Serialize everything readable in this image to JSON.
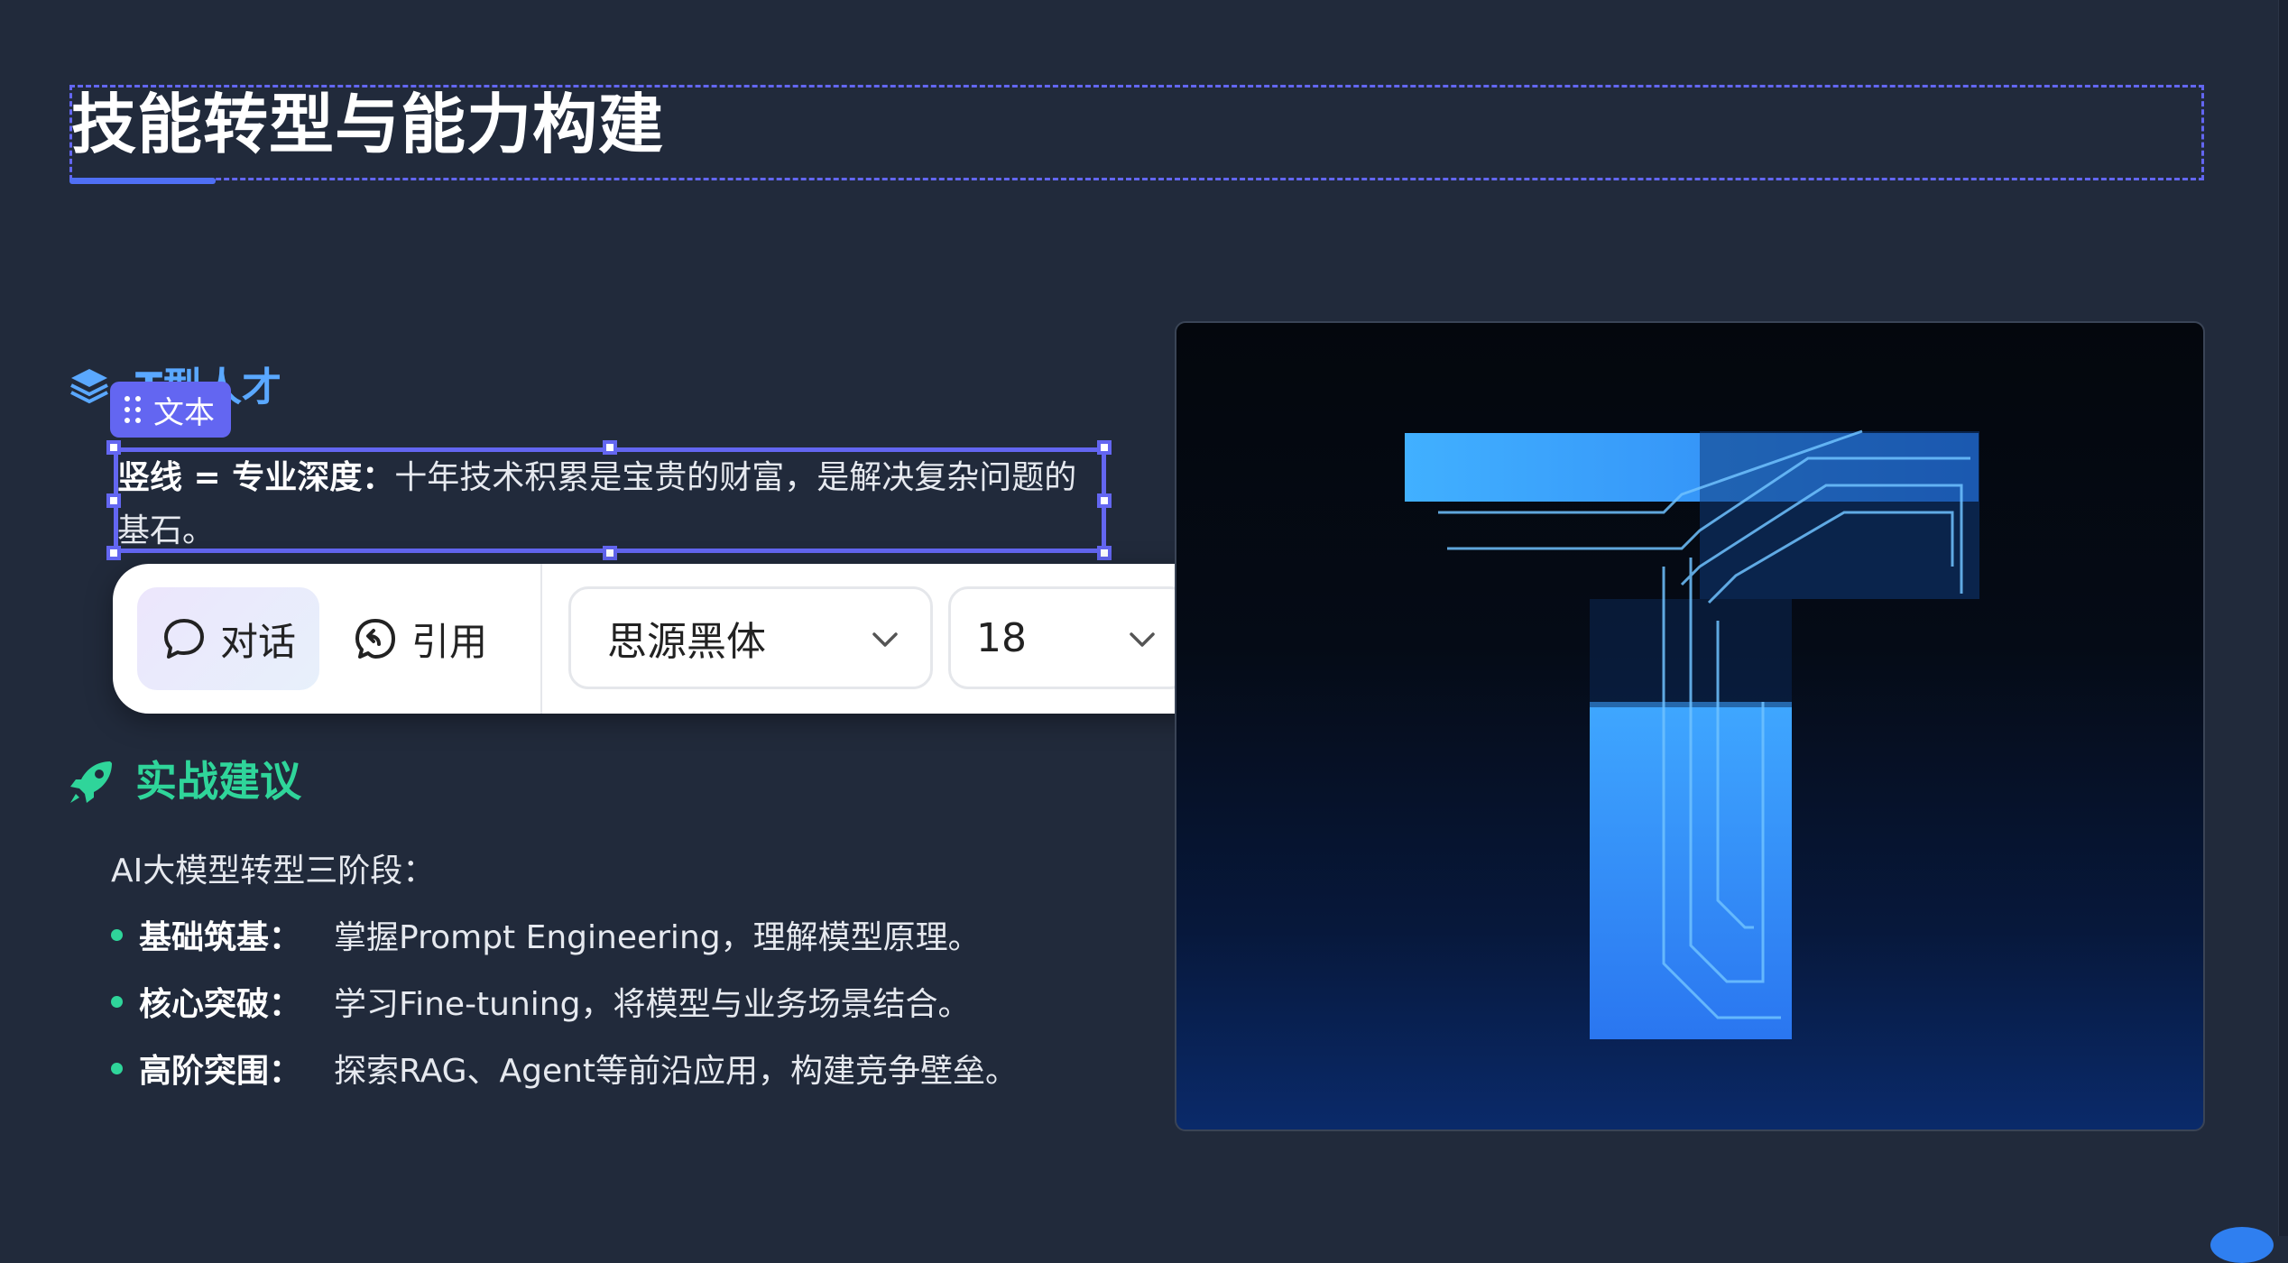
{
  "title": "技能转型与能力构建",
  "section1": {
    "heading": "T型人才",
    "tag_label": "文本",
    "selected_text": {
      "bold": "竖线 = 专业深度：",
      "rest": "十年技术积累是宝贵的财富，是解决复杂问题的基石。"
    }
  },
  "toolbar": {
    "chat_label": "对话",
    "quote_label": "引用",
    "font_family": "思源黑体",
    "font_size": "18",
    "icons": [
      "chat-icon",
      "quote-icon",
      "chevron-down-icon",
      "text-style-icon",
      "bold-icon",
      "italic-icon",
      "underline-icon",
      "trash-icon"
    ]
  },
  "section2": {
    "heading": "实战建议",
    "intro": "AI大模型转型三阶段：",
    "items": [
      {
        "label": "基础筑基：",
        "text": "掌握Prompt Engineering，理解模型原理。"
      },
      {
        "label": "核心突破：",
        "text": "学习Fine-tuning，将模型与业务场景结合。"
      },
      {
        "label": "高阶突围：",
        "text": "探索RAG、Agent等前沿应用，构建竞争壁垒。"
      }
    ]
  },
  "image": {
    "icon": "t-letter-circuit-illustration"
  },
  "colors": {
    "background": "#212a3b",
    "accent": "#6366f1",
    "section1": "#5aa8ff",
    "section2": "#2fd59a"
  }
}
